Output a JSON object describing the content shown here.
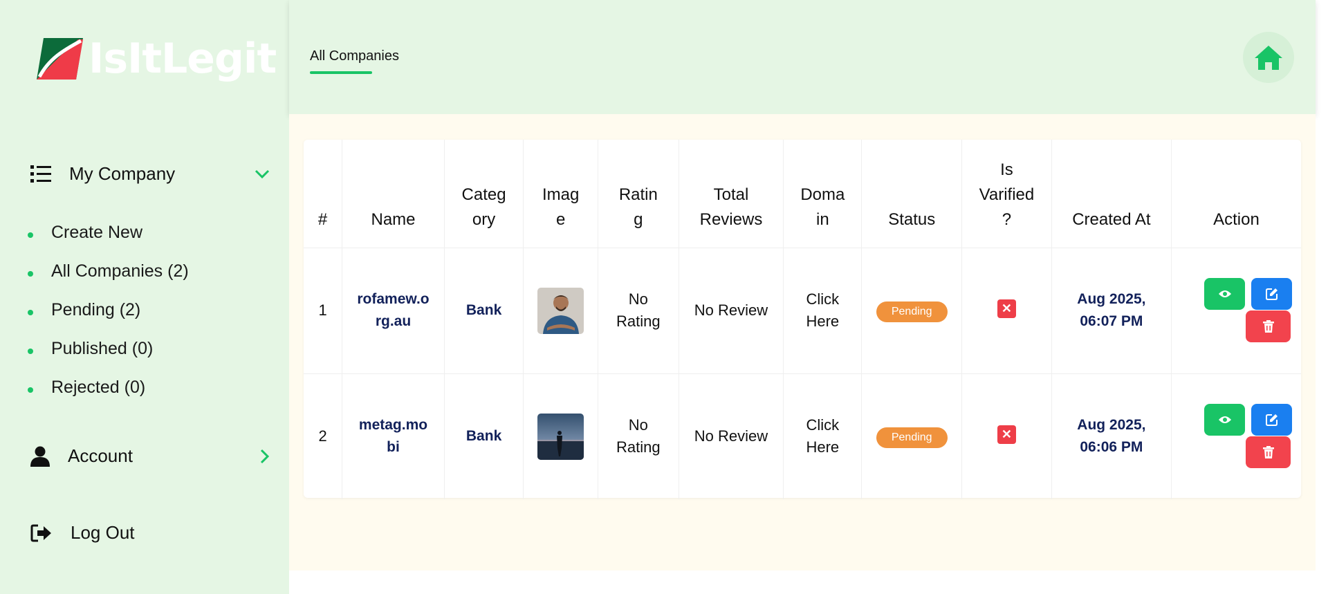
{
  "app": {
    "logo_text": "IsItLegit"
  },
  "sidebar": {
    "company_menu": {
      "label": "My Company",
      "icon": "list-icon",
      "chevron": "chevron-down-icon"
    },
    "company_items": [
      {
        "label": "Create New"
      },
      {
        "label": "All Companies (2)"
      },
      {
        "label": "Pending (2)"
      },
      {
        "label": "Published (0)"
      },
      {
        "label": "Rejected (0)"
      }
    ],
    "account_menu": {
      "label": "Account",
      "icon": "user-icon",
      "chevron": "chevron-right-icon"
    },
    "logout": {
      "label": "Log Out",
      "icon": "logout-icon"
    }
  },
  "header": {
    "tab_label": "All Companies",
    "home_icon": "home-icon"
  },
  "table": {
    "headers": [
      "#",
      "Name",
      "Categ ory",
      "Imag e",
      "Ratin g",
      "Total Reviews",
      "Doma in",
      "Status",
      "Is Varified ?",
      "Created At",
      "Action"
    ],
    "rows": [
      {
        "index": "1",
        "name": "rofamew.org.au",
        "category": "Bank",
        "image": "person-photo",
        "rating": "No Rating",
        "total_reviews": "No Review",
        "domain": "Click Here",
        "status": "Pending",
        "verified_icon": "x-icon",
        "created_at": "Aug 2025, 06:07 PM"
      },
      {
        "index": "2",
        "name": "metag.mobi",
        "category": "Bank",
        "image": "silhouette-photo",
        "rating": "No Rating",
        "total_reviews": "No Review",
        "domain": "Click Here",
        "status": "Pending",
        "verified_icon": "x-icon",
        "created_at": "Aug 2025, 06:06 PM"
      }
    ]
  },
  "colors": {
    "sidebar_bg": "#e5f6e4",
    "content_bg": "#fffbef",
    "accent_green": "#19c466",
    "text_navy": "#12215a",
    "pending_orange": "#f0923c",
    "edit_blue": "#1a7ff0",
    "delete_red": "#f2434d"
  }
}
